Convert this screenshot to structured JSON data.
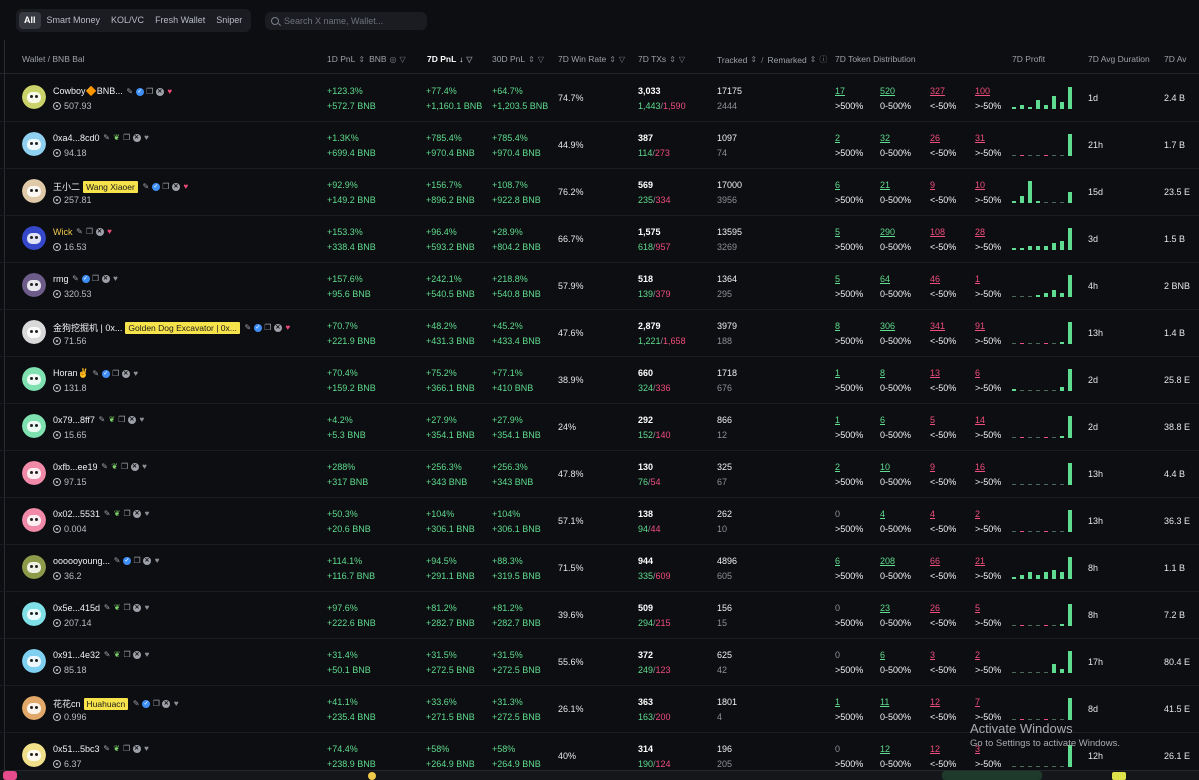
{
  "tabs": [
    "All",
    "Smart Money",
    "KOL/VC",
    "Fresh Wallet",
    "Sniper"
  ],
  "search_placeholder": "Search X name, Wallet...",
  "headers": {
    "wallet": "Wallet / BNB Bal",
    "pnl1d": "1D PnL",
    "bnb": "BNB",
    "pnl7d": "7D PnL",
    "pnl30d": "30D PnL",
    "winrate": "7D Win Rate",
    "txs": "7D TXs",
    "tracked": "Tracked",
    "remarked": "Remarked",
    "dist": "7D Token Distribution",
    "profit": "7D Profit",
    "duration": "7D Avg Duration",
    "avg": "7D Av"
  },
  "dist_labels": [
    ">500%",
    "0-500%",
    "<-50%",
    ">-50%"
  ],
  "colors": {
    "green": "#5fdc8f",
    "red": "#ef4d7d",
    "tag": "#f6e24b"
  },
  "rows": [
    {
      "name": "Cowboy🔶BNB...",
      "tag": "",
      "gold": false,
      "bal": "507.93",
      "av": "#c9d36a",
      "p1a": "+123.3%",
      "p1b": "+572.7 BNB",
      "p7a": "+77.4%",
      "p7b": "+1,160.1 BNB",
      "p30a": "+64.7%",
      "p30b": "+1,203.5 BNB",
      "win": "74.7%",
      "tx": "3,033",
      "txg": "1,443",
      "txr": "1,590",
      "tr": "17175",
      "rm": "2444",
      "d1": "17",
      "d2": "520",
      "d3": "327",
      "d4": "100",
      "bars": [
        0.1,
        0.2,
        0.1,
        0.4,
        0.2,
        0.6,
        0.3,
        1.0
      ],
      "dur": "1d",
      "avg": "2.4 B",
      "leaf": false,
      "heart": true,
      "blue": true
    },
    {
      "name": "0xa4...8cd0",
      "tag": "",
      "gold": false,
      "bal": "94.18",
      "av": "#8fd0f0",
      "p1a": "+1.3K%",
      "p1b": "+699.4 BNB",
      "p7a": "+785.4%",
      "p7b": "+970.4 BNB",
      "p30a": "+785.4%",
      "p30b": "+970.4 BNB",
      "win": "44.9%",
      "tx": "387",
      "txg": "114",
      "txr": "273",
      "tr": "1097",
      "rm": "74",
      "d1": "2",
      "d2": "32",
      "d3": "26",
      "d4": "31",
      "bars": [
        0.03,
        0.03,
        0.03,
        0.03,
        0.03,
        0.03,
        0.03,
        1.0
      ],
      "dur": "21h",
      "avg": "1.7 B",
      "leaf": true,
      "heart": false,
      "blue": false
    },
    {
      "name": "王小二",
      "tag": "Wang Xiaoer",
      "gold": false,
      "bal": "257.81",
      "av": "#e0c9a8",
      "p1a": "+92.9%",
      "p1b": "+149.2 BNB",
      "p7a": "+156.7%",
      "p7b": "+896.2 BNB",
      "p30a": "+108.7%",
      "p30b": "+922.8 BNB",
      "win": "76.2%",
      "tx": "569",
      "txg": "235",
      "txr": "334",
      "tr": "17000",
      "rm": "3956",
      "d1": "6",
      "d2": "21",
      "d3": "9",
      "d4": "10",
      "bars": [
        0.1,
        0.3,
        1.0,
        0.1,
        0.03,
        0.03,
        0.03,
        0.5
      ],
      "dur": "15d",
      "avg": "23.5 E",
      "leaf": false,
      "heart": true,
      "blue": true
    },
    {
      "name": "Wick",
      "tag": "",
      "gold": true,
      "bal": "16.53",
      "av": "#3548c9",
      "p1a": "+153.3%",
      "p1b": "+338.4 BNB",
      "p7a": "+96.4%",
      "p7b": "+593.2 BNB",
      "p30a": "+28.9%",
      "p30b": "+804.2 BNB",
      "win": "66.7%",
      "tx": "1,575",
      "txg": "618",
      "txr": "957",
      "tr": "13595",
      "rm": "3269",
      "d1": "5",
      "d2": "290",
      "d3": "108",
      "d4": "28",
      "bars": [
        0.1,
        0.1,
        0.2,
        0.2,
        0.2,
        0.3,
        0.4,
        1.0
      ],
      "dur": "3d",
      "avg": "1.5 B",
      "leaf": false,
      "heart": true,
      "blue": false
    },
    {
      "name": "rmg",
      "tag": "",
      "gold": false,
      "bal": "320.53",
      "av": "#6d5c8a",
      "p1a": "+157.6%",
      "p1b": "+95.6 BNB",
      "p7a": "+242.1%",
      "p7b": "+540.5 BNB",
      "p30a": "+218.8%",
      "p30b": "+540.8 BNB",
      "win": "57.9%",
      "tx": "518",
      "txg": "139",
      "txr": "379",
      "tr": "1364",
      "rm": "295",
      "d1": "5",
      "d2": "64",
      "d3": "46",
      "d4": "1",
      "bars": [
        0.03,
        0.03,
        0.05,
        0.1,
        0.2,
        0.3,
        0.2,
        1.0
      ],
      "dur": "4h",
      "avg": "2 BNB",
      "leaf": false,
      "heart": false,
      "blue": true
    },
    {
      "name": "金狗挖掘机 | 0x...",
      "tag": "Golden Dog Excavator | 0x...",
      "gold": false,
      "bal": "71.56",
      "av": "#d9d9d9",
      "p1a": "+70.7%",
      "p1b": "+221.9 BNB",
      "p7a": "+48.2%",
      "p7b": "+431.3 BNB",
      "p30a": "+45.2%",
      "p30b": "+433.4 BNB",
      "win": "47.6%",
      "tx": "2,879",
      "txg": "1,221",
      "txr": "1,658",
      "tr": "3979",
      "rm": "188",
      "d1": "8",
      "d2": "306",
      "d3": "341",
      "d4": "91",
      "bars": [
        0.03,
        0.03,
        0.03,
        0.03,
        0.03,
        0.03,
        0.1,
        1.0
      ],
      "dur": "13h",
      "avg": "1.4 B",
      "leaf": false,
      "heart": true,
      "blue": true
    },
    {
      "name": "Horan✌",
      "tag": "",
      "gold": false,
      "bal": "131.8",
      "av": "#7fe0b0",
      "p1a": "+70.4%",
      "p1b": "+159.2 BNB",
      "p7a": "+75.2%",
      "p7b": "+366.1 BNB",
      "p30a": "+77.1%",
      "p30b": "+410 BNB",
      "win": "38.9%",
      "tx": "660",
      "txg": "324",
      "txr": "336",
      "tr": "1718",
      "rm": "676",
      "d1": "1",
      "d2": "8",
      "d3": "13",
      "d4": "6",
      "bars": [
        0.1,
        0.03,
        0.03,
        0.03,
        0.03,
        0.03,
        0.2,
        1.0
      ],
      "dur": "2d",
      "avg": "25.8 E",
      "leaf": false,
      "heart": false,
      "blue": true
    },
    {
      "name": "0x79...8ff7",
      "tag": "",
      "gold": false,
      "bal": "15.65",
      "av": "#7fe0b0",
      "p1a": "+4.2%",
      "p1b": "+5.3 BNB",
      "p7a": "+27.9%",
      "p7b": "+354.1 BNB",
      "p30a": "+27.9%",
      "p30b": "+354.1 BNB",
      "win": "24%",
      "tx": "292",
      "txg": "152",
      "txr": "140",
      "tr": "866",
      "rm": "12",
      "d1": "1",
      "d2": "6",
      "d3": "5",
      "d4": "14",
      "bars": [
        0.03,
        0.03,
        0.03,
        0.03,
        0.03,
        0.03,
        0.1,
        1.0
      ],
      "dur": "2d",
      "avg": "38.8 E",
      "leaf": true,
      "heart": false,
      "blue": false
    },
    {
      "name": "0xfb...ee19",
      "tag": "",
      "gold": false,
      "bal": "97.15",
      "av": "#f08aa8",
      "p1a": "+288%",
      "p1b": "+317 BNB",
      "p7a": "+256.3%",
      "p7b": "+343 BNB",
      "p30a": "+256.3%",
      "p30b": "+343 BNB",
      "win": "47.8%",
      "tx": "130",
      "txg": "76",
      "txr": "54",
      "tr": "325",
      "rm": "67",
      "d1": "2",
      "d2": "10",
      "d3": "9",
      "d4": "16",
      "bars": [
        0.03,
        0.03,
        0.03,
        0.03,
        0.03,
        0.03,
        0.03,
        1.0
      ],
      "dur": "13h",
      "avg": "4.4 B",
      "leaf": true,
      "heart": false,
      "blue": false
    },
    {
      "name": "0x02...5531",
      "tag": "",
      "gold": false,
      "bal": "0.004",
      "av": "#f08aa8",
      "p1a": "+50.3%",
      "p1b": "+20.6 BNB",
      "p7a": "+104%",
      "p7b": "+306.1 BNB",
      "p30a": "+104%",
      "p30b": "+306.1 BNB",
      "win": "57.1%",
      "tx": "138",
      "txg": "94",
      "txr": "44",
      "tr": "262",
      "rm": "10",
      "d1": "0",
      "d2": "4",
      "d3": "4",
      "d4": "2",
      "bars": [
        0.03,
        0.03,
        0.03,
        0.03,
        0.03,
        0.03,
        0.03,
        1.0
      ],
      "dur": "13h",
      "avg": "36.3 E",
      "leaf": true,
      "heart": false,
      "blue": false
    },
    {
      "name": "oooooyoung...",
      "tag": "",
      "gold": false,
      "bal": "36.2",
      "av": "#8d9a4a",
      "p1a": "+114.1%",
      "p1b": "+116.7 BNB",
      "p7a": "+94.5%",
      "p7b": "+291.1 BNB",
      "p30a": "+88.3%",
      "p30b": "+319.5 BNB",
      "win": "71.5%",
      "tx": "944",
      "txg": "335",
      "txr": "609",
      "tr": "4896",
      "rm": "605",
      "d1": "6",
      "d2": "208",
      "d3": "66",
      "d4": "21",
      "bars": [
        0.1,
        0.2,
        0.3,
        0.2,
        0.3,
        0.4,
        0.3,
        1.0
      ],
      "dur": "8h",
      "avg": "1.1 B",
      "leaf": false,
      "heart": false,
      "blue": true
    },
    {
      "name": "0x5e...415d",
      "tag": "",
      "gold": false,
      "bal": "207.14",
      "av": "#7fe0e8",
      "p1a": "+97.6%",
      "p1b": "+222.6 BNB",
      "p7a": "+81.2%",
      "p7b": "+282.7 BNB",
      "p30a": "+81.2%",
      "p30b": "+282.7 BNB",
      "win": "39.6%",
      "tx": "509",
      "txg": "294",
      "txr": "215",
      "tr": "156",
      "rm": "15",
      "d1": "0",
      "d2": "23",
      "d3": "26",
      "d4": "5",
      "bars": [
        0.03,
        0.03,
        0.03,
        0.03,
        0.03,
        0.03,
        0.1,
        1.0
      ],
      "dur": "8h",
      "avg": "7.2 B",
      "leaf": true,
      "heart": false,
      "blue": false
    },
    {
      "name": "0x91...4e32",
      "tag": "",
      "gold": false,
      "bal": "85.18",
      "av": "#7fd0f0",
      "p1a": "+31.4%",
      "p1b": "+50.1 BNB",
      "p7a": "+31.5%",
      "p7b": "+272.5 BNB",
      "p30a": "+31.5%",
      "p30b": "+272.5 BNB",
      "win": "55.6%",
      "tx": "372",
      "txg": "249",
      "txr": "123",
      "tr": "625",
      "rm": "42",
      "d1": "0",
      "d2": "6",
      "d3": "3",
      "d4": "2",
      "bars": [
        0.03,
        0.03,
        0.03,
        0.03,
        0.03,
        0.4,
        0.2,
        1.0
      ],
      "dur": "17h",
      "avg": "80.4 E",
      "leaf": true,
      "heart": false,
      "blue": false
    },
    {
      "name": "花花cn",
      "tag": "Huahuacn",
      "gold": false,
      "bal": "0.996",
      "av": "#e2a86a",
      "p1a": "+41.1%",
      "p1b": "+235.4 BNB",
      "p7a": "+33.6%",
      "p7b": "+271.5 BNB",
      "p30a": "+31.3%",
      "p30b": "+272.5 BNB",
      "win": "26.1%",
      "tx": "363",
      "txg": "163",
      "txr": "200",
      "tr": "1801",
      "rm": "4",
      "d1": "1",
      "d2": "11",
      "d3": "12",
      "d4": "7",
      "bars": [
        0.03,
        0.03,
        0.03,
        0.03,
        0.03,
        0.03,
        0.03,
        1.0
      ],
      "dur": "8d",
      "avg": "41.5 E",
      "leaf": false,
      "heart": false,
      "blue": true
    },
    {
      "name": "0x51...5bc3",
      "tag": "",
      "gold": false,
      "bal": "6.37",
      "av": "#f0e08a",
      "p1a": "+74.4%",
      "p1b": "+238.9 BNB",
      "p7a": "+58%",
      "p7b": "+264.9 BNB",
      "p30a": "+58%",
      "p30b": "+264.9 BNB",
      "win": "40%",
      "tx": "314",
      "txg": "190",
      "txr": "124",
      "tr": "196",
      "rm": "205",
      "d1": "0",
      "d2": "12",
      "d3": "12",
      "d4": "3",
      "bars": [
        0.03,
        0.03,
        0.03,
        0.03,
        0.03,
        0.03,
        0.03,
        1.0
      ],
      "dur": "12h",
      "avg": "26.1 E",
      "leaf": true,
      "heart": false,
      "blue": false
    }
  ],
  "watermark": {
    "title": "Activate Windows",
    "sub": "Go to Settings to activate Windows."
  }
}
